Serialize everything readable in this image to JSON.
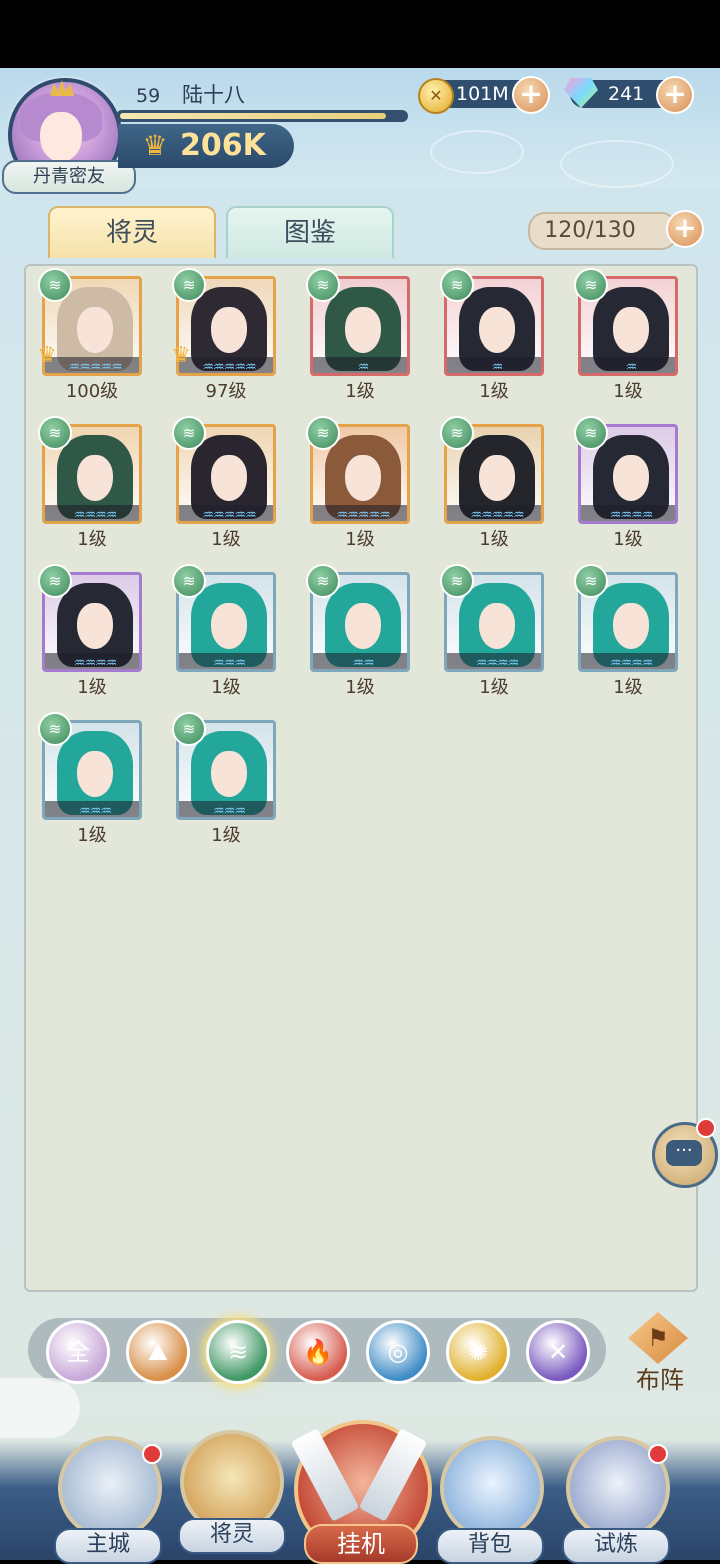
{
  "player": {
    "level": "59",
    "name": "陆十八",
    "title": "丹青密友",
    "power": "206K",
    "xp_fraction": 0.93
  },
  "resources": {
    "coins": "101M",
    "gems": "241"
  },
  "tabs": {
    "active": "将灵",
    "other": "图鉴"
  },
  "capacity": "120/130",
  "heroes": [
    {
      "level": "100级",
      "frame": "#e4a24a",
      "hair": "#cdbba6",
      "bg": "#f0d8b6",
      "stars": 5,
      "crown": true
    },
    {
      "level": "97级",
      "frame": "#e4a24a",
      "hair": "#2d2a33",
      "bg": "#efd8ba",
      "stars": 5,
      "crown": true
    },
    {
      "level": "1级",
      "frame": "#d66a6a",
      "hair": "#2f5846",
      "bg": "#f1cdd0",
      "stars": 1,
      "crown": false
    },
    {
      "level": "1级",
      "frame": "#d66a6a",
      "hair": "#262833",
      "bg": "#f3d2d5",
      "stars": 1,
      "crown": false
    },
    {
      "level": "1级",
      "frame": "#d66a6a",
      "hair": "#262833",
      "bg": "#f3d2d5",
      "stars": 1,
      "crown": false
    },
    {
      "level": "1级",
      "frame": "#e4a24a",
      "hair": "#2f5846",
      "bg": "#efd5b0",
      "stars": 4,
      "crown": false
    },
    {
      "level": "1级",
      "frame": "#e4a24a",
      "hair": "#2a2630",
      "bg": "#efd5b0",
      "stars": 5,
      "crown": false
    },
    {
      "level": "1级",
      "frame": "#e4a24a",
      "hair": "#8a5a3a",
      "bg": "#f0c9a6",
      "stars": 5,
      "crown": false
    },
    {
      "level": "1级",
      "frame": "#e4a24a",
      "hair": "#25262c",
      "bg": "#e7d2ae",
      "stars": 5,
      "crown": false
    },
    {
      "level": "1级",
      "frame": "#a57bd0",
      "hair": "#262833",
      "bg": "#dccbe8",
      "stars": 4,
      "crown": false
    },
    {
      "level": "1级",
      "frame": "#a57bd0",
      "hair": "#262833",
      "bg": "#dccbe8",
      "stars": 4,
      "crown": false
    },
    {
      "level": "1级",
      "frame": "#7ea7bc",
      "hair": "#23a79b",
      "bg": "#d4e3ea",
      "stars": 3,
      "crown": false
    },
    {
      "level": "1级",
      "frame": "#7ea7bc",
      "hair": "#23a79b",
      "bg": "#d4e3ea",
      "stars": 2,
      "crown": false
    },
    {
      "level": "1级",
      "frame": "#7ea7bc",
      "hair": "#23a79b",
      "bg": "#d4e3ea",
      "stars": 4,
      "crown": false
    },
    {
      "level": "1级",
      "frame": "#7ea7bc",
      "hair": "#23a79b",
      "bg": "#d4e3ea",
      "stars": 4,
      "crown": false
    },
    {
      "level": "1级",
      "frame": "#7ea7bc",
      "hair": "#23a79b",
      "bg": "#d4e3ea",
      "stars": 3,
      "crown": false
    },
    {
      "level": "1级",
      "frame": "#7ea7bc",
      "hair": "#23a79b",
      "bg": "#d4e3ea",
      "stars": 3,
      "crown": false
    }
  ],
  "filters": [
    {
      "name": "all",
      "glyph": "全",
      "color": "#c8a8d8",
      "active": false
    },
    {
      "name": "mountain",
      "glyph": "⛰",
      "color": "#d88f48",
      "active": false
    },
    {
      "name": "wind",
      "glyph": "≋",
      "color": "#3f9865",
      "active": true
    },
    {
      "name": "fire",
      "glyph": "🔥",
      "color": "#d65c4f",
      "active": false
    },
    {
      "name": "water",
      "glyph": "◎",
      "color": "#3f8cc6",
      "active": false
    },
    {
      "name": "light",
      "glyph": "✺",
      "color": "#e1b12e",
      "active": false
    },
    {
      "name": "dark",
      "glyph": "✕",
      "color": "#7a5ac0",
      "active": false
    }
  ],
  "formation_label": "布阵",
  "nav": {
    "main_city": "主城",
    "heroes": "将灵",
    "idle": "挂机",
    "bag": "背包",
    "trial": "试炼"
  }
}
